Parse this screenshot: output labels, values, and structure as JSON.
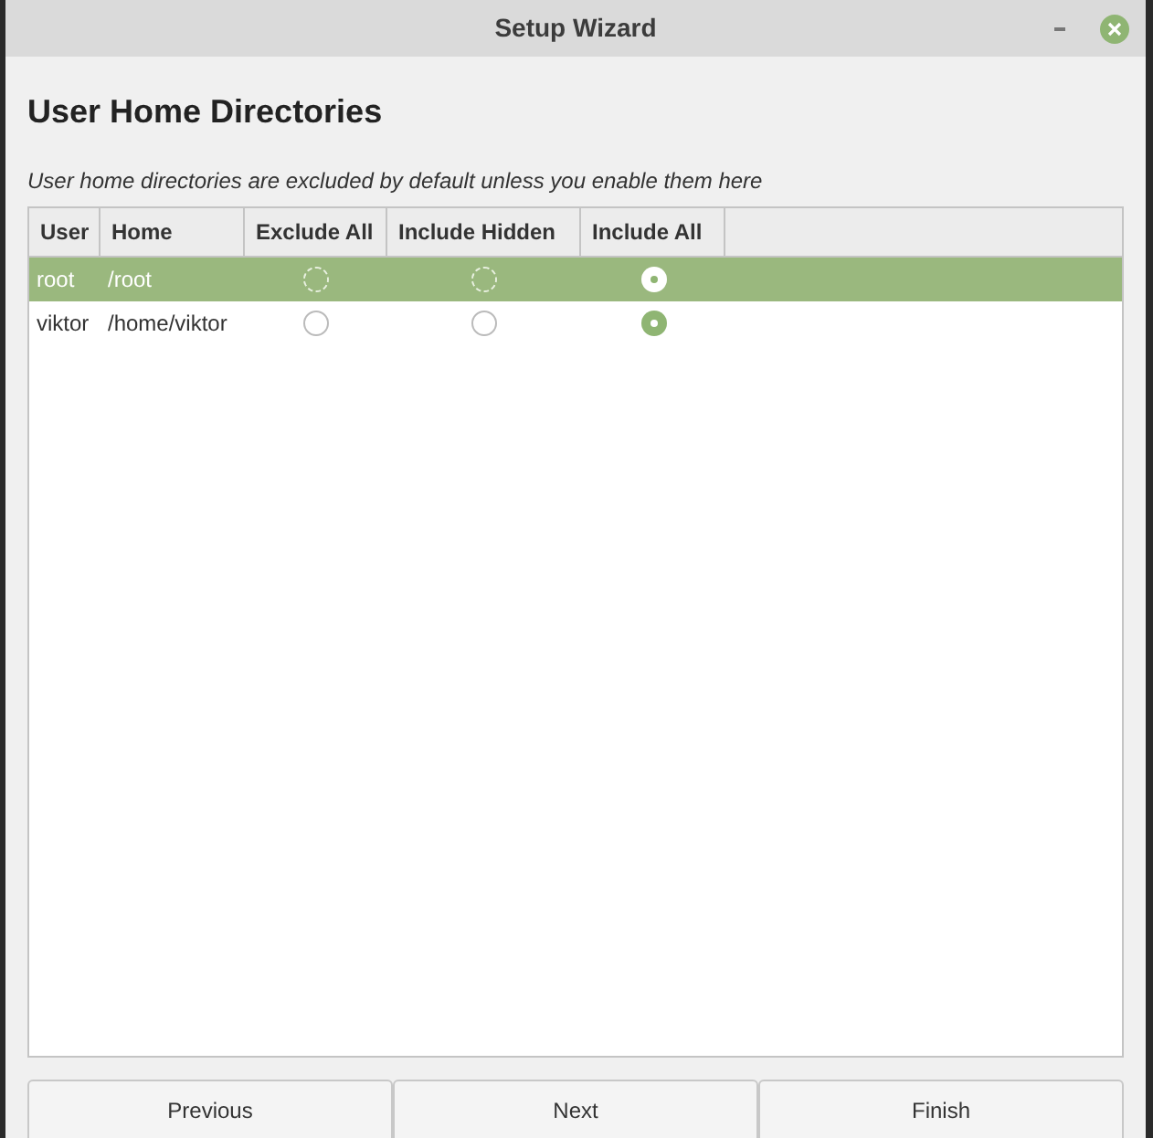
{
  "window": {
    "title": "Setup Wizard"
  },
  "heading": "User Home Directories",
  "description": "User home directories are excluded by default unless you enable them here",
  "table": {
    "columns": [
      "User",
      "Home",
      "Exclude All",
      "Include Hidden",
      "Include All"
    ],
    "rows": [
      {
        "user": "root",
        "home": "/root",
        "selected": true,
        "options": [
          {
            "selected": false
          },
          {
            "selected": false
          },
          {
            "selected": true
          }
        ]
      },
      {
        "user": "viktor",
        "home": "/home/viktor",
        "selected": false,
        "options": [
          {
            "selected": false
          },
          {
            "selected": false
          },
          {
            "selected": true
          }
        ]
      }
    ]
  },
  "buttons": [
    "Previous",
    "Next",
    "Finish"
  ]
}
